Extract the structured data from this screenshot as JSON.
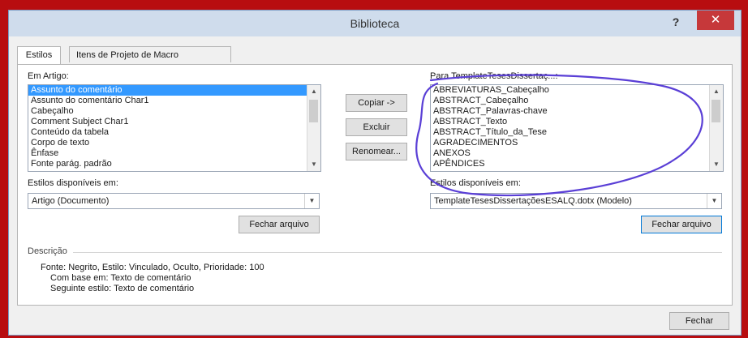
{
  "window": {
    "title": "Biblioteca",
    "help_glyph": "?",
    "close_glyph": "✕"
  },
  "tabs": [
    {
      "label": "Estilos"
    },
    {
      "label": "Itens de Projeto de Macro"
    }
  ],
  "left": {
    "list_label": "Em Artigo:",
    "items": [
      "Assunto do comentário",
      "Assunto do comentário Char1",
      "Cabeçalho",
      "Comment Subject Char1",
      "Conteúdo da tabela",
      "Corpo de texto",
      "Ênfase",
      "Fonte parág. padrão"
    ],
    "selected_index": 0,
    "available_label": "Estilos disponíveis em:",
    "available_value": "Artigo (Documento)",
    "close_file_label": "Fechar arquivo"
  },
  "middle": {
    "copy_label": "Copiar ->",
    "delete_label": "Excluir",
    "rename_label": "Renomear..."
  },
  "right": {
    "list_label": "Para TemplateTesesDissertaç...:",
    "items": [
      "ABREVIATURAS_Cabeçalho",
      "ABSTRACT_Cabeçalho",
      "ABSTRACT_Palavras-chave",
      "ABSTRACT_Texto",
      "ABSTRACT_Título_da_Tese",
      "AGRADECIMENTOS",
      "ANEXOS",
      "APÊNDICES"
    ],
    "available_label": "Estilos disponíveis em:",
    "available_value": "TemplateTesesDissertaçõesESALQ.dotx (Modelo)",
    "close_file_label": "Fechar arquivo"
  },
  "description": {
    "label": "Descrição",
    "line1": "Fonte: Negrito, Estilo: Vinculado, Oculto, Prioridade: 100",
    "line2": "Com base em: Texto de comentário",
    "line3": "Seguinte estilo: Texto de comentário"
  },
  "footer": {
    "close_label": "Fechar"
  },
  "colors": {
    "border_red": "#b80d10",
    "selection_blue": "#3399ff",
    "annotation_purple": "#5a3fd6"
  }
}
